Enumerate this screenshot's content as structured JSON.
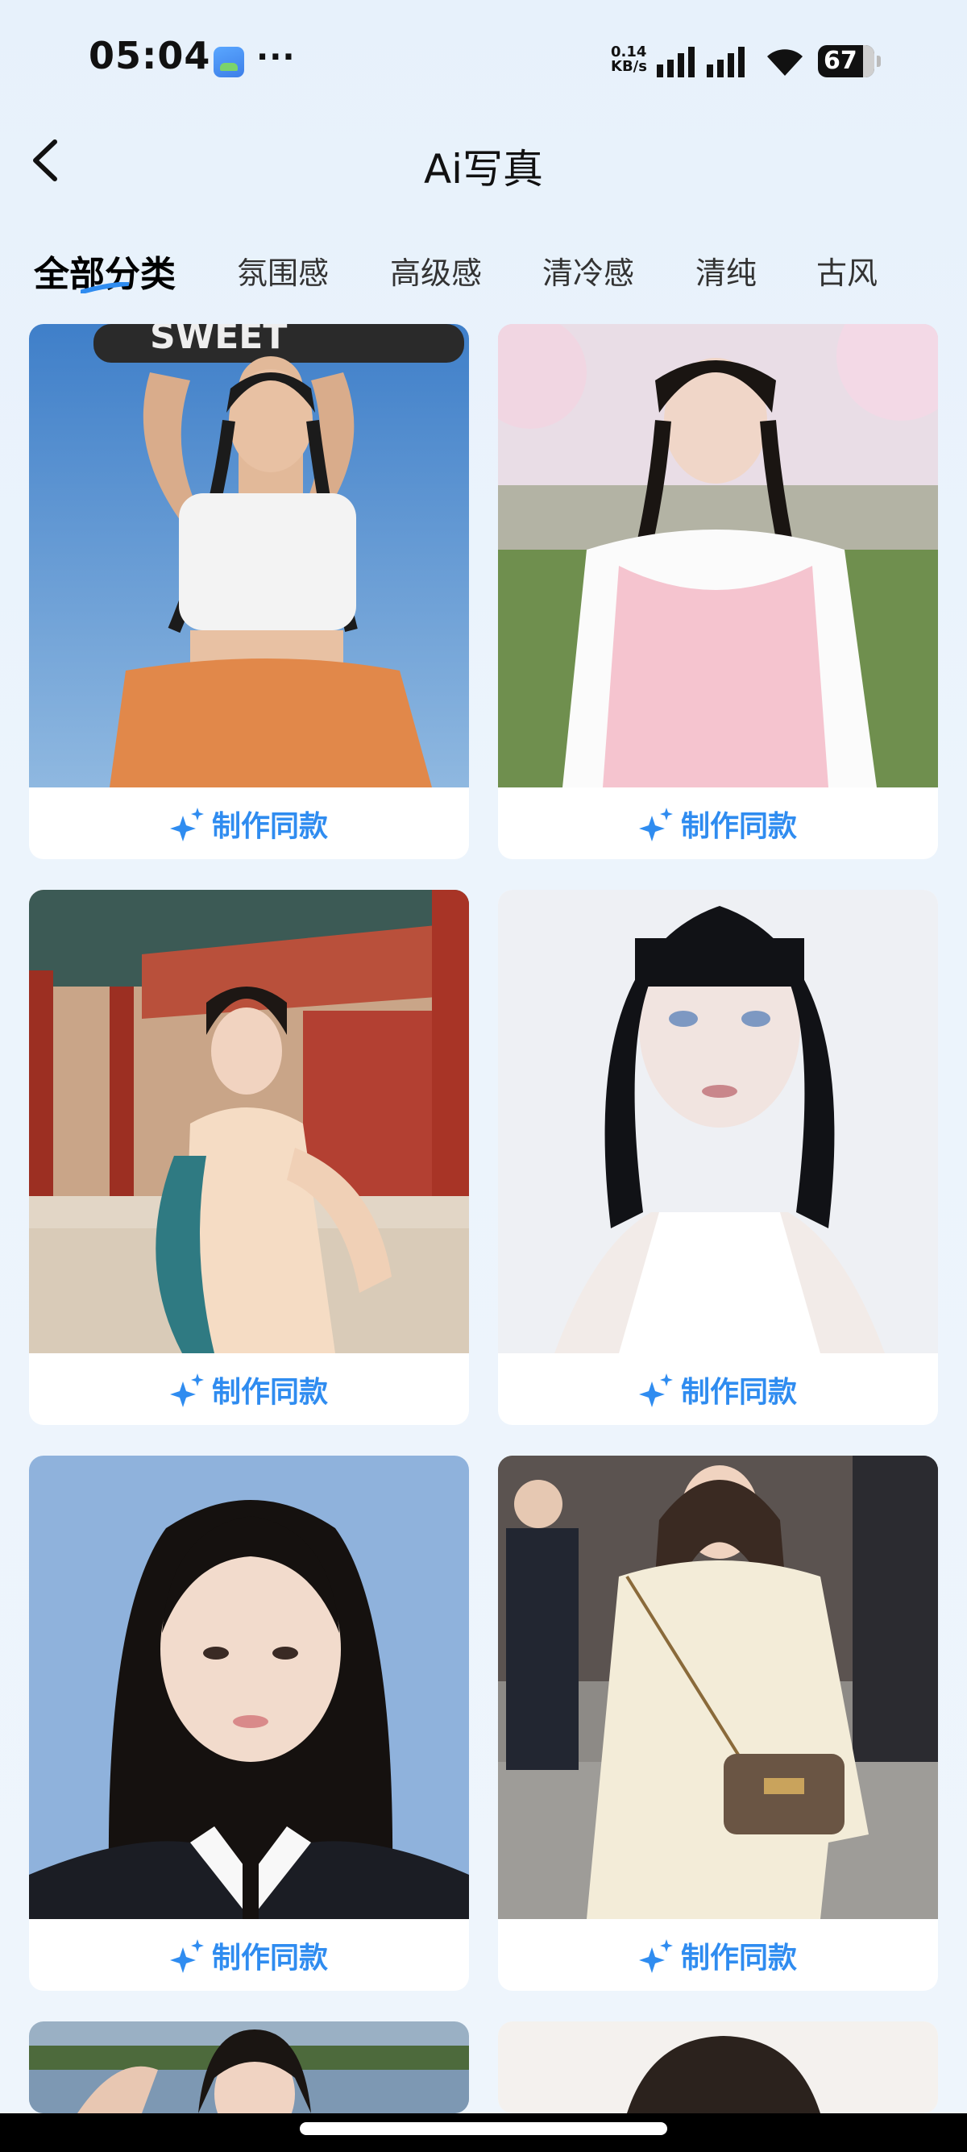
{
  "status_bar": {
    "time": "05:04",
    "more": "···",
    "net_speed_value": "0.14",
    "net_speed_unit": "KB/s",
    "battery": "67"
  },
  "nav": {
    "title": "Ai写真"
  },
  "tabs": [
    {
      "label": "全部分类",
      "active": true
    },
    {
      "label": "氛围感",
      "active": false
    },
    {
      "label": "高级感",
      "active": false
    },
    {
      "label": "清冷感",
      "active": false
    },
    {
      "label": "清纯",
      "active": false
    },
    {
      "label": "古风",
      "active": false
    }
  ],
  "cards": [
    {
      "action_label": "制作同款",
      "photo": "girl-skateboard-braids"
    },
    {
      "action_label": "制作同款",
      "photo": "girl-pink-vest-cherry-blossom"
    },
    {
      "action_label": "制作同款",
      "photo": "girl-hanfu-palace"
    },
    {
      "action_label": "制作同款",
      "photo": "girl-black-bob-portrait"
    },
    {
      "action_label": "制作同款",
      "photo": "girl-suit-blue-background"
    },
    {
      "action_label": "制作同款",
      "photo": "girl-sweater-street"
    }
  ],
  "colors": {
    "accent": "#2f8cf0",
    "background": "#ecf4fc"
  }
}
